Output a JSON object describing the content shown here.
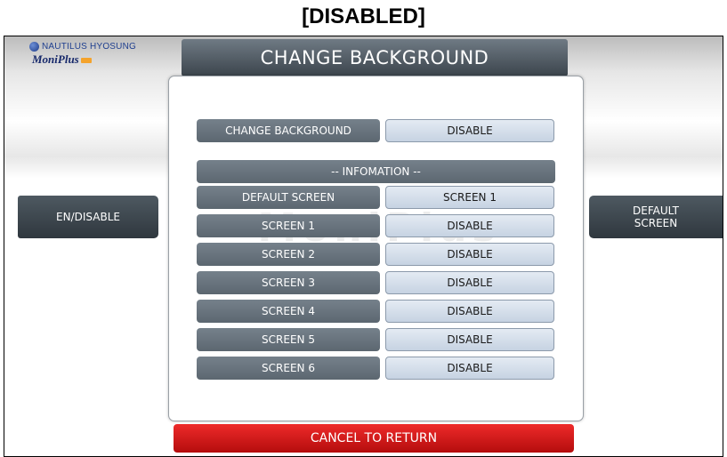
{
  "caption": "[DISABLED]",
  "logo": {
    "brand": "NAUTILUS HYOSUNG",
    "product": "MoniPlus"
  },
  "title": "CHANGE BACKGROUND",
  "side_buttons": {
    "left": "EN/DISABLE",
    "right_line1": "DEFAULT",
    "right_line2": "SCREEN"
  },
  "main_setting": {
    "label": "CHANGE BACKGROUND",
    "value": "DISABLE"
  },
  "info_header": "-- INFOMATION --",
  "default_screen": {
    "label": "DEFAULT SCREEN",
    "value": "SCREEN 1"
  },
  "screens": [
    {
      "label": "SCREEN 1",
      "value": "DISABLE"
    },
    {
      "label": "SCREEN 2",
      "value": "DISABLE"
    },
    {
      "label": "SCREEN 3",
      "value": "DISABLE"
    },
    {
      "label": "SCREEN 4",
      "value": "DISABLE"
    },
    {
      "label": "SCREEN 5",
      "value": "DISABLE"
    },
    {
      "label": "SCREEN 6",
      "value": "DISABLE"
    }
  ],
  "cancel_label": "CANCEL TO RETURN",
  "colors": {
    "title_bar": "#4a545c",
    "label_cell": "#68747e",
    "value_cell": "#d3ddea",
    "cancel": "#d41818"
  }
}
